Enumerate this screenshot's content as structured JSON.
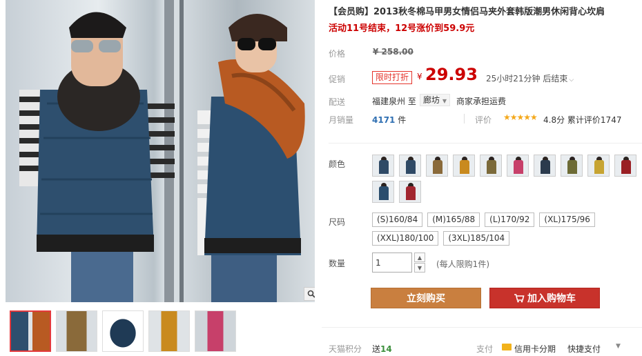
{
  "product": {
    "title": "【会员购】2013秋冬棉马甲男女情侣马夹外套韩版潮男休闲背心坎肩",
    "subtitle": "活动11号结束，12号涨价到59.9元"
  },
  "price": {
    "label": "价格",
    "original": "¥ 258.00",
    "promo_label": "促销",
    "promo_tag": "限时打折",
    "yen": "¥",
    "current": "29.93",
    "countdown": "25小时21分钟 后结束"
  },
  "shipping": {
    "label": "配送",
    "from": "福建泉州",
    "to_word": "至",
    "to": "廊坊",
    "fee": "商家承担运费"
  },
  "sales": {
    "label": "月销量",
    "count": "4171",
    "unit": "件",
    "review_label": "评价",
    "stars": "★★★★★",
    "rating": "4.8分",
    "total_reviews": "累计评价1747"
  },
  "color": {
    "label": "颜色",
    "swatches": [
      {
        "name": "swatch-1",
        "color": "#2f4a66"
      },
      {
        "name": "swatch-2",
        "color": "#2f4a66"
      },
      {
        "name": "swatch-3",
        "color": "#8a6a3a"
      },
      {
        "name": "swatch-4",
        "color": "#c98a1e"
      },
      {
        "name": "swatch-5",
        "color": "#7b6a3a"
      },
      {
        "name": "swatch-6",
        "color": "#c7406a"
      },
      {
        "name": "swatch-7",
        "color": "#2b3b4d"
      },
      {
        "name": "swatch-8",
        "color": "#6d6b35"
      },
      {
        "name": "swatch-9",
        "color": "#c7a432"
      },
      {
        "name": "swatch-10",
        "color": "#9a1f24"
      },
      {
        "name": "swatch-11",
        "color": "#2a4d6d"
      },
      {
        "name": "swatch-12",
        "color": "#a12630"
      }
    ]
  },
  "size": {
    "label": "尺码",
    "options": [
      "(S)160/84",
      "(M)165/88",
      "(L)170/92",
      "(XL)175/96",
      "(XXL)180/100",
      "(3XL)185/104"
    ]
  },
  "quantity": {
    "label": "数量",
    "value": "1",
    "up": "▲",
    "down": "▼",
    "note": "(每人限购1件)"
  },
  "actions": {
    "buy_now": "立刻购买",
    "add_to_cart": "加入购物车",
    "cart_icon": "cart-icon"
  },
  "footer": {
    "points_label": "天猫积分",
    "points_prefix": "送",
    "points_value": "14",
    "pay_label": "支付",
    "credit_card": "信用卡分期",
    "fast_pay": "快捷支付",
    "more": "▼"
  },
  "gallery": {
    "zoom_icon": "magnifier-icon"
  }
}
